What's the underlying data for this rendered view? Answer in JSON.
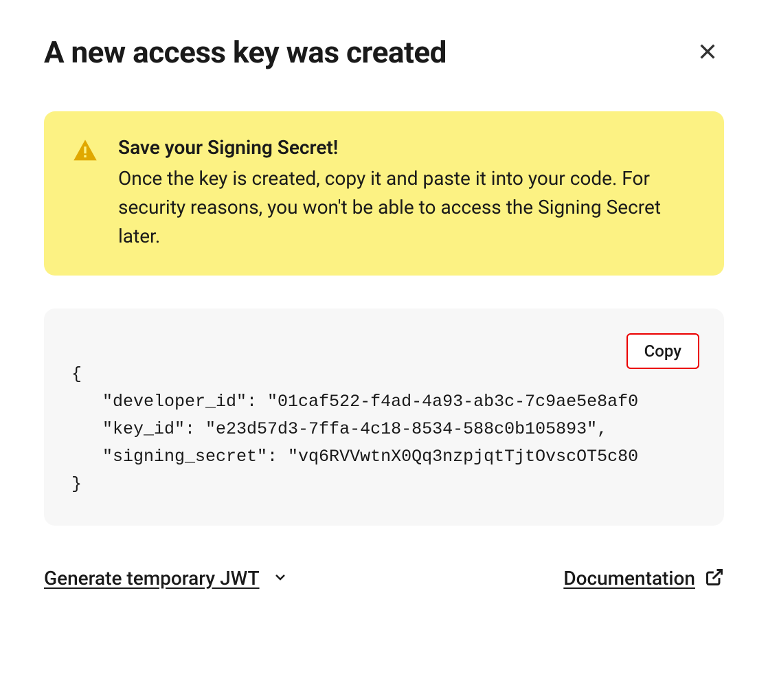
{
  "modal": {
    "title": "A new access key was created"
  },
  "alert": {
    "title": "Save your Signing Secret!",
    "text": "Once the key is created, copy it and paste it into your code. For security reasons, you won't be able to access the Signing Secret later."
  },
  "code": {
    "copy_label": "Copy",
    "content": "{\n   \"developer_id\": \"01caf522-f4ad-4a93-ab3c-7c9ae5e8af0\n   \"key_id\": \"e23d57d3-7ffa-4c18-8534-588c0b105893\",\n   \"signing_secret\": \"vq6RVVwtnX0Qq3nzpjqtTjtOvscOT5c80\n}"
  },
  "footer": {
    "jwt_label": "Generate temporary JWT",
    "doc_label": "Documentation"
  }
}
